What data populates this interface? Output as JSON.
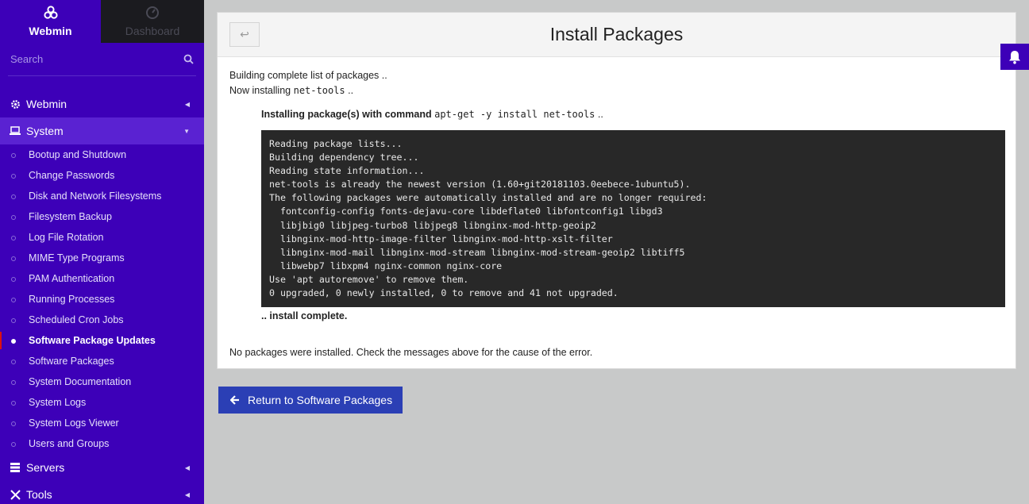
{
  "sidebar": {
    "tabs": [
      {
        "label": "Webmin",
        "icon": "webmin-logo-icon"
      },
      {
        "label": "Dashboard",
        "icon": "dashboard-gauge-icon"
      }
    ],
    "search_placeholder": "Search",
    "categories": {
      "webmin": "Webmin",
      "system": "System",
      "servers": "Servers",
      "tools": "Tools"
    },
    "system_items": [
      "Bootup and Shutdown",
      "Change Passwords",
      "Disk and Network Filesystems",
      "Filesystem Backup",
      "Log File Rotation",
      "MIME Type Programs",
      "PAM Authentication",
      "Running Processes",
      "Scheduled Cron Jobs",
      "Software Package Updates",
      "Software Packages",
      "System Documentation",
      "System Logs",
      "System Logs Viewer",
      "Users and Groups"
    ],
    "active_item": "Software Package Updates"
  },
  "panel": {
    "title": "Install Packages",
    "line1": "Building complete list of packages ..",
    "line2_prefix": "Now installing ",
    "line2_pkg": "net-tools",
    "line2_suffix": " ..",
    "cmd_prefix": "Installing package(s) with command ",
    "cmd": "apt-get -y install net-tools",
    "cmd_suffix": " ..",
    "output": "Reading package lists...\nBuilding dependency tree...\nReading state information...\nnet-tools is already the newest version (1.60+git20181103.0eebece-1ubuntu5).\nThe following packages were automatically installed and are no longer required:\n  fontconfig-config fonts-dejavu-core libdeflate0 libfontconfig1 libgd3\n  libjbig0 libjpeg-turbo8 libjpeg8 libnginx-mod-http-geoip2\n  libnginx-mod-http-image-filter libnginx-mod-http-xslt-filter\n  libnginx-mod-mail libnginx-mod-stream libnginx-mod-stream-geoip2 libtiff5\n  libwebp7 libxpm4 nginx-common nginx-core\nUse 'apt autoremove' to remove them.\n0 upgraded, 0 newly installed, 0 to remove and 41 not upgraded.",
    "complete": ".. install complete.",
    "final": "No packages were installed. Check the messages above for the cause of the error."
  },
  "return_button": "Return to Software Packages",
  "colors": {
    "sidebar": "#3d00b8",
    "accent_button": "#2b3fb5",
    "terminal_bg": "#282828"
  }
}
